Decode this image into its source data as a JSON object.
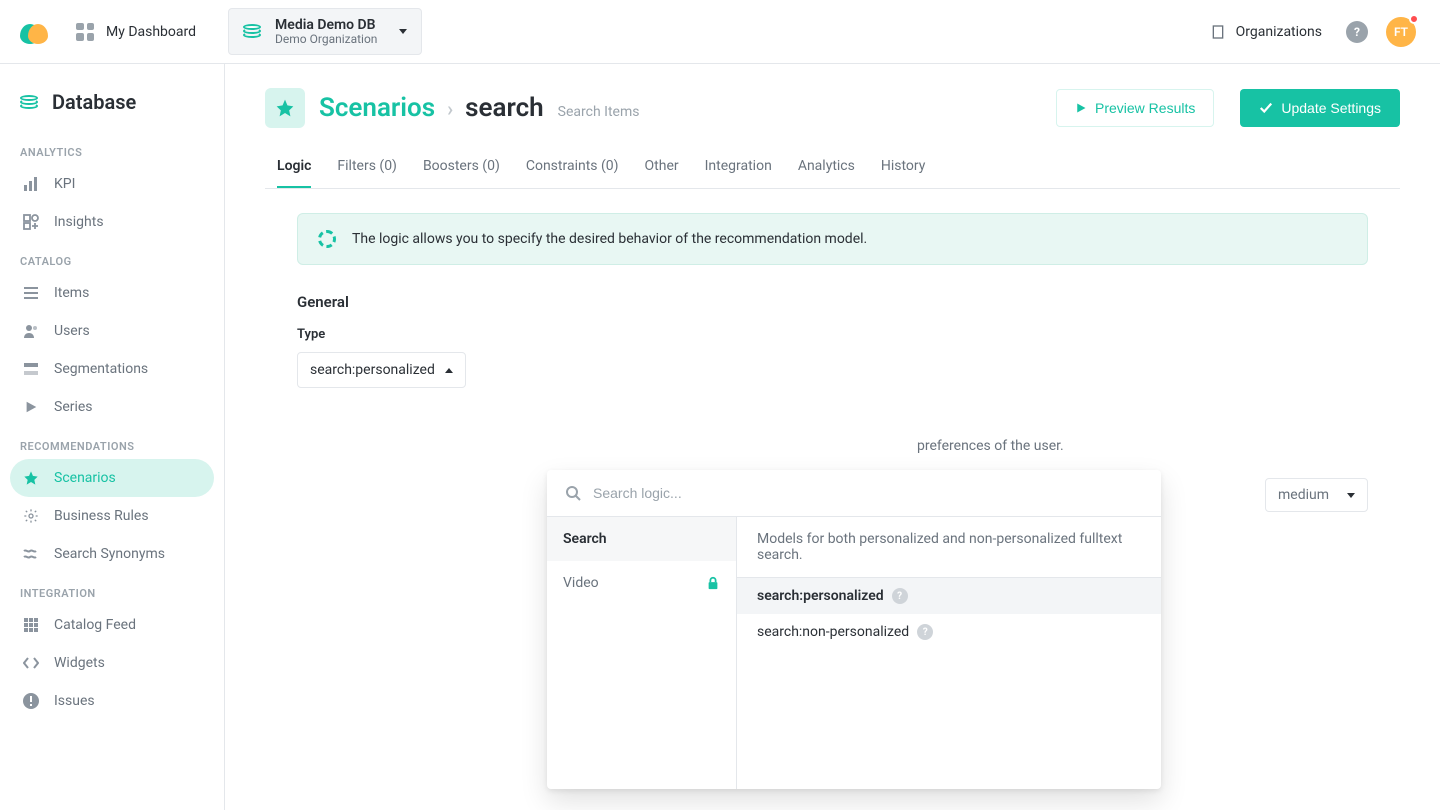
{
  "topbar": {
    "dashboard_label": "My Dashboard",
    "db_name": "Media Demo DB",
    "db_org": "Demo Organization",
    "organizations_label": "Organizations",
    "help_glyph": "?",
    "avatar_initials": "FT"
  },
  "sidebar": {
    "title": "Database",
    "groups": {
      "analytics": "ANALYTICS",
      "catalog": "CATALOG",
      "recommendations": "RECOMMENDATIONS",
      "integration": "INTEGRATION"
    },
    "kpi": "KPI",
    "insights": "Insights",
    "items": "Items",
    "users": "Users",
    "segmentations": "Segmentations",
    "series": "Series",
    "scenarios": "Scenarios",
    "business_rules": "Business Rules",
    "search_synonyms": "Search Synonyms",
    "catalog_feed": "Catalog Feed",
    "widgets": "Widgets",
    "issues": "Issues"
  },
  "breadcrumb": {
    "root": "Scenarios",
    "leaf": "search",
    "sub": "Search Items"
  },
  "buttons": {
    "preview": "Preview Results",
    "update": "Update Settings"
  },
  "tabs": {
    "logic": "Logic",
    "filters": "Filters (0)",
    "boosters": "Boosters (0)",
    "constraints": "Constraints (0)",
    "other": "Other",
    "integration": "Integration",
    "analytics": "Analytics",
    "history": "History"
  },
  "banner": "The logic allows you to specify the desired behavior of the recommendation model.",
  "general": {
    "heading": "General",
    "type_label": "Type",
    "type_value": "search:personalized",
    "right_text": "preferences of the user."
  },
  "relevance_select": "medium",
  "dropdown": {
    "placeholder": "Search logic...",
    "cat_search": "Search",
    "cat_video": "Video",
    "help": "Models for both personalized and non-personalized fulltext search.",
    "opt_personalized": "search:personalized",
    "opt_nonpersonalized": "search:non-personalized",
    "q": "?"
  }
}
